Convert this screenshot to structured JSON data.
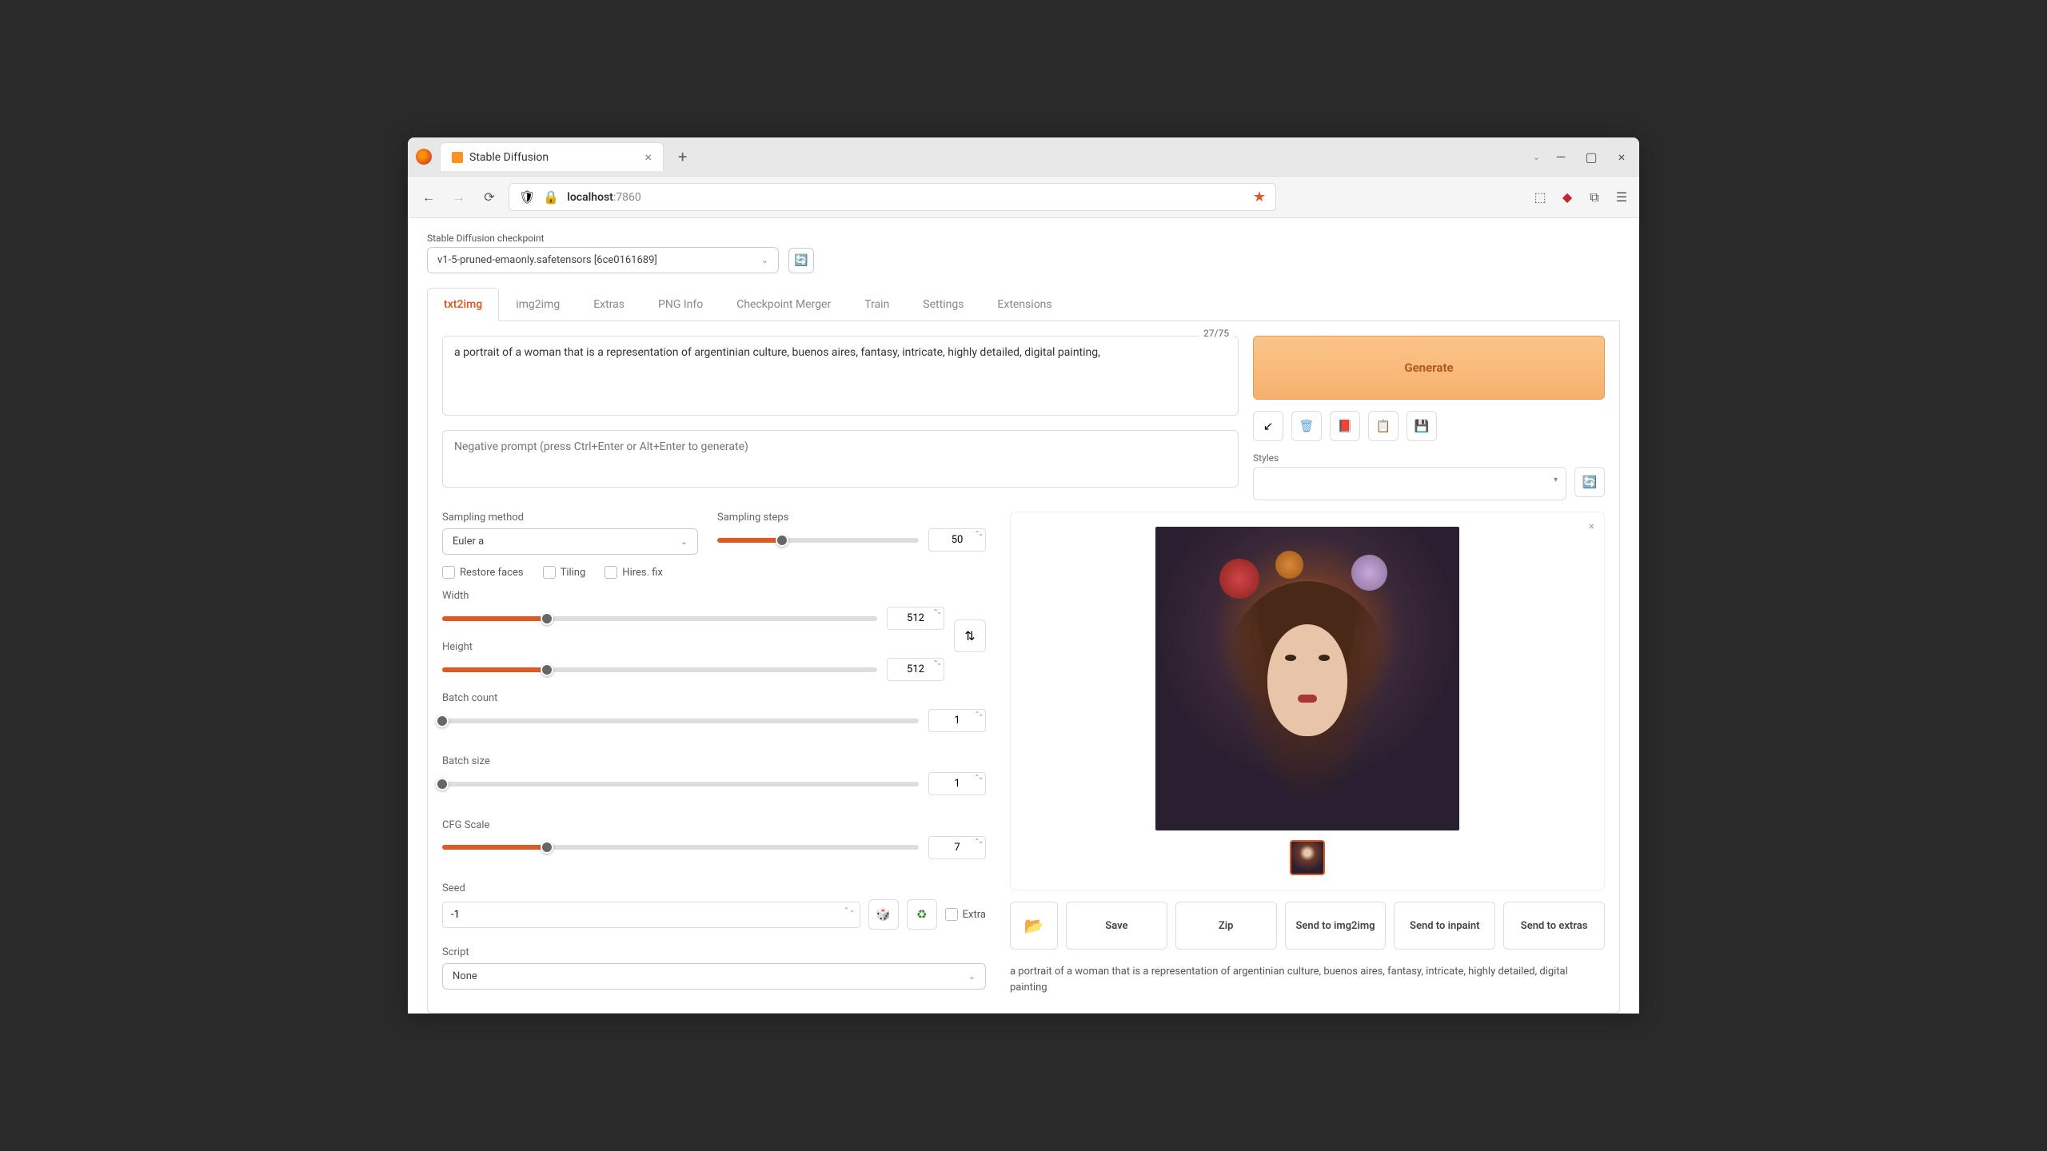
{
  "browser": {
    "tab_title": "Stable Diffusion",
    "url_host": "localhost",
    "url_port": ":7860"
  },
  "checkpoint": {
    "label": "Stable Diffusion checkpoint",
    "value": "v1-5-pruned-emaonly.safetensors [6ce0161689]"
  },
  "tabs": [
    "txt2img",
    "img2img",
    "Extras",
    "PNG Info",
    "Checkpoint Merger",
    "Train",
    "Settings",
    "Extensions"
  ],
  "prompt": {
    "text": "a portrait of a woman that is a representation of argentinian culture, buenos aires, fantasy, intricate, highly detailed, digital painting,",
    "token_count": "27/75",
    "neg_placeholder": "Negative prompt (press Ctrl+Enter or Alt+Enter to generate)"
  },
  "generate_label": "Generate",
  "styles_label": "Styles",
  "sampling": {
    "method_label": "Sampling method",
    "method_value": "Euler a",
    "steps_label": "Sampling steps",
    "steps_value": "50"
  },
  "checks": {
    "restore": "Restore faces",
    "tiling": "Tiling",
    "hires": "Hires. fix"
  },
  "width": {
    "label": "Width",
    "value": "512"
  },
  "height": {
    "label": "Height",
    "value": "512"
  },
  "batch_count": {
    "label": "Batch count",
    "value": "1"
  },
  "batch_size": {
    "label": "Batch size",
    "value": "1"
  },
  "cfg": {
    "label": "CFG Scale",
    "value": "7"
  },
  "seed": {
    "label": "Seed",
    "value": "-1",
    "extra": "Extra"
  },
  "script": {
    "label": "Script",
    "value": "None"
  },
  "actions": {
    "save": "Save",
    "zip": "Zip",
    "img2img": "Send to img2img",
    "inpaint": "Send to inpaint",
    "extras": "Send to extras"
  },
  "output_text": "a portrait of a woman that is a representation of argentinian culture, buenos aires, fantasy, intricate, highly detailed, digital painting"
}
